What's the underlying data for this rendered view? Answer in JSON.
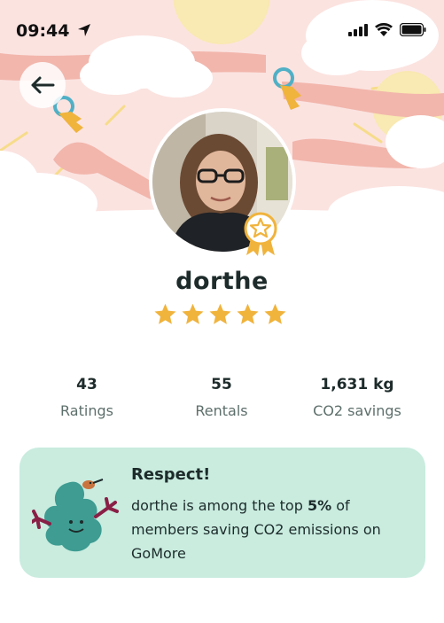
{
  "status_bar": {
    "time": "09:44"
  },
  "profile": {
    "username": "dorthe",
    "rating_stars": 5
  },
  "stats": [
    {
      "value": "43",
      "label": "Ratings"
    },
    {
      "value": "55",
      "label": "Rentals"
    },
    {
      "value": "1,631 kg",
      "label": "CO2 savings"
    }
  ],
  "respect_card": {
    "title": "Respect!",
    "text_prefix": "dorthe is among the top ",
    "text_highlight": "5%",
    "text_suffix": " of members saving CO2 emissions on GoMore"
  },
  "colors": {
    "hero_background": "#fbe3e0",
    "card_background": "#c9ecdf",
    "star": "#f0b33c",
    "text": "#1d2b2a",
    "muted_text": "#5d6f6b"
  },
  "icons": {
    "back": "arrow-left-icon",
    "badge": "award-ribbon-icon",
    "location": "location-arrow-icon",
    "signal": "cellular-signal-icon",
    "wifi": "wifi-icon",
    "battery": "battery-icon"
  }
}
